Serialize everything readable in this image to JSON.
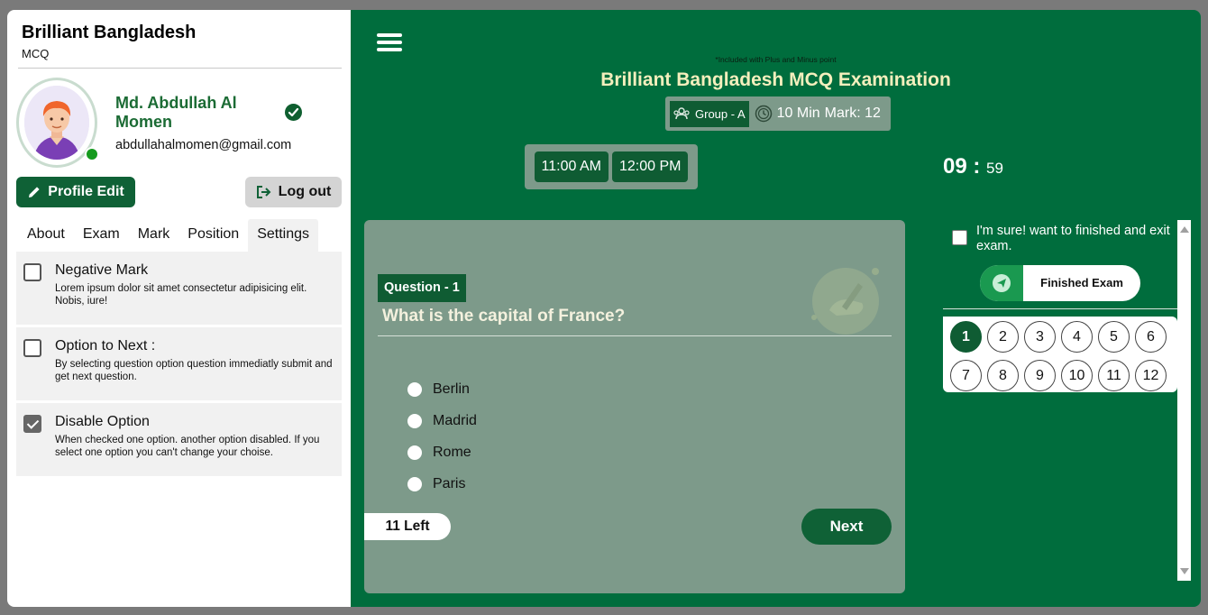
{
  "sidebar": {
    "brand_title": "Brilliant Bangladesh",
    "brand_sub": "MCQ",
    "user": {
      "name": "Md. Abdullah Al Momen",
      "email": "abdullahalmomen@gmail.com",
      "verified": true,
      "online": true
    },
    "buttons": {
      "profile_edit": "Profile Edit",
      "logout": "Log out"
    },
    "tabs": [
      {
        "label": "About",
        "active": false
      },
      {
        "label": "Exam",
        "active": false
      },
      {
        "label": "Mark",
        "active": false
      },
      {
        "label": "Position",
        "active": false
      },
      {
        "label": "Settings",
        "active": true
      }
    ],
    "settings": [
      {
        "title": "Negative Mark",
        "desc": "Lorem ipsum dolor sit amet consectetur adipisicing elit. Nobis, iure!",
        "checked": false
      },
      {
        "title": "Option to Next :",
        "desc": "By selecting question option question immediatly submit and get next question.",
        "checked": false
      },
      {
        "title": "Disable Option",
        "desc": "When checked one option. another option disabled. If you select one option you can't change your choise.",
        "checked": true
      }
    ]
  },
  "exam": {
    "note": "*Included with Plus and Minus point",
    "title": "Brilliant Bangladesh MCQ Examination",
    "group": "Group - A",
    "duration": "10 Min",
    "mark": "Mark: 12",
    "start_time": "11:00 AM",
    "end_time": "12:00 PM",
    "countdown_min": "09",
    "countdown_sep": ":",
    "countdown_sec": "59"
  },
  "question": {
    "badge": "Question - 1",
    "text": "What is the capital of France?",
    "options": [
      "Berlin",
      "Madrid",
      "Rome",
      "Paris"
    ],
    "left": "11 Left",
    "next_label": "Next"
  },
  "panel": {
    "confirm_text": "I'm sure! want to finished and exit exam.",
    "confirm_checked": false,
    "finish_label": "Finished Exam",
    "question_numbers": [
      "1",
      "2",
      "3",
      "4",
      "5",
      "6",
      "7",
      "8",
      "9",
      "10",
      "11",
      "12"
    ],
    "active_question": "1"
  },
  "colors": {
    "primary_green": "#006d3d",
    "dark_green": "#0f5c33",
    "card_gray_green": "#7d9a8a",
    "title_cream": "#f4efbd"
  }
}
